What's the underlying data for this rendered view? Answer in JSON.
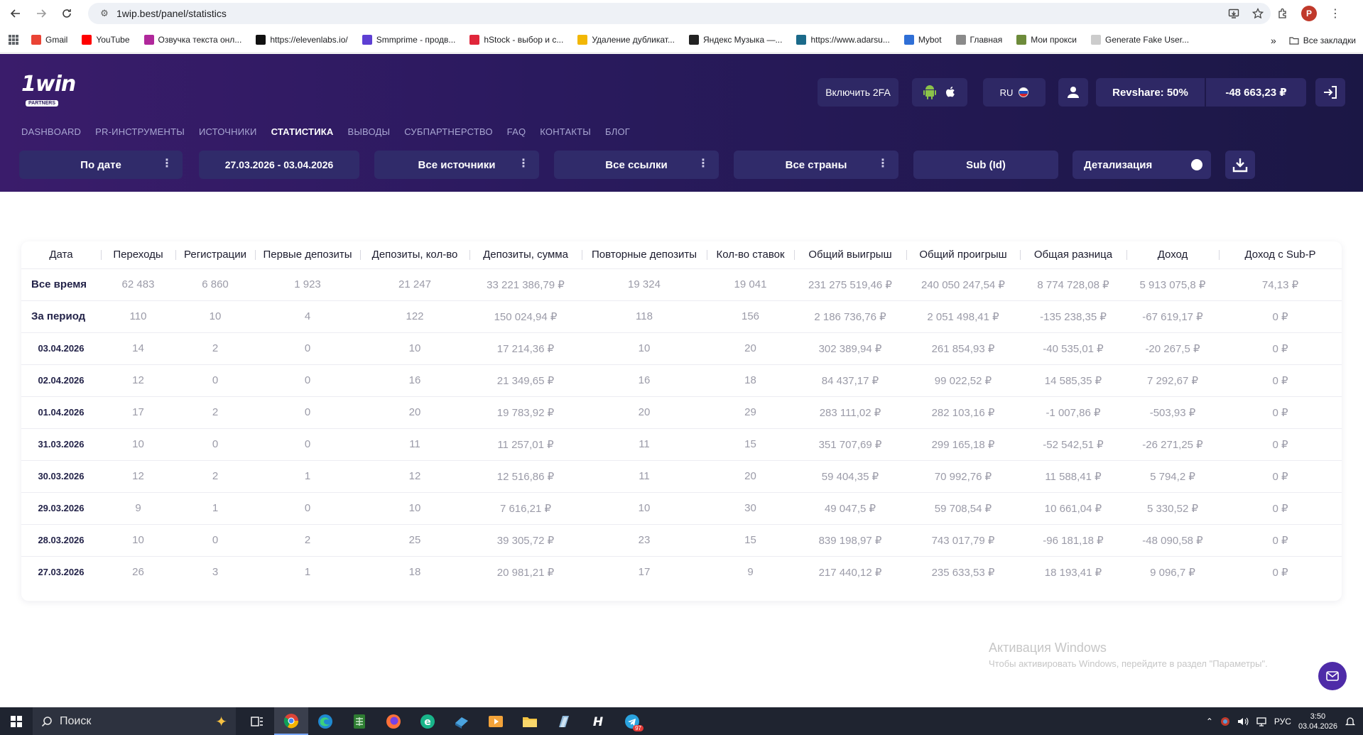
{
  "browser": {
    "url": "1wip.best/panel/statistics",
    "bookmarks": [
      {
        "label": "Gmail",
        "color": "#ea4335"
      },
      {
        "label": "YouTube",
        "color": "#ff0000"
      },
      {
        "label": "Озвучка текста онл...",
        "color": "#b0289b"
      },
      {
        "label": "https://elevenlabs.io/",
        "color": "#111111"
      },
      {
        "label": "Smmprime - продв...",
        "color": "#5d3fd3"
      },
      {
        "label": "hStock - выбор и с...",
        "color": "#e0263a"
      },
      {
        "label": "Удаление дубликат...",
        "color": "#f2b705"
      },
      {
        "label": "Яндекс Музыка —...",
        "color": "#222222"
      },
      {
        "label": "https://www.adarsu...",
        "color": "#1b6a8a"
      },
      {
        "label": "Mybot",
        "color": "#2f6fd6"
      },
      {
        "label": "Главная",
        "color": "#8a8a8a"
      },
      {
        "label": "Мои прокси",
        "color": "#6d8b3a"
      },
      {
        "label": "Generate Fake User...",
        "color": "#cccccc"
      }
    ],
    "all_bookmarks_label": "Все закладки",
    "profile_letter": "P"
  },
  "header": {
    "logo_text": "1win",
    "logo_sub": "PARTNERS",
    "twofa_label": "Включить 2FA",
    "lang_label": "RU",
    "revshare_label": "Revshare: 50%",
    "balance_label": "-48 663,23 ₽"
  },
  "nav": [
    {
      "label": "DASHBOARD",
      "active": false
    },
    {
      "label": "PR-ИНСТРУМЕНТЫ",
      "active": false
    },
    {
      "label": "ИСТОЧНИКИ",
      "active": false
    },
    {
      "label": "СТАТИСТИКА",
      "active": true
    },
    {
      "label": "ВЫВОДЫ",
      "active": false
    },
    {
      "label": "СУБПАРТНЕРСТВО",
      "active": false
    },
    {
      "label": "FAQ",
      "active": false
    },
    {
      "label": "КОНТАКТЫ",
      "active": false
    },
    {
      "label": "БЛОГ",
      "active": false
    }
  ],
  "filters": {
    "by_date": "По дате",
    "date_range": "27.03.2026 - 03.04.2026",
    "sources": "Все источники",
    "links": "Все ссылки",
    "countries": "Все страны",
    "sub": "Sub (Id)",
    "detail": "Детализация"
  },
  "table": {
    "columns": [
      "Дата",
      "Переходы",
      "Регистрации",
      "Первые депозиты",
      "Депозиты, кол-во",
      "Депозиты, сумма",
      "Повторные депозиты",
      "Кол-во ставок",
      "Общий выигрыш",
      "Общий проигрыш",
      "Общая разница",
      "Доход",
      "Доход с Sub-P"
    ],
    "rows": [
      {
        "kind": "summary",
        "cells": [
          "Все время",
          "62 483",
          "6 860",
          "1 923",
          "21 247",
          "33 221 386,79 ₽",
          "19 324",
          "19 041",
          "231 275 519,46 ₽",
          "240 050 247,54 ₽",
          "8 774 728,08 ₽",
          "5 913 075,8 ₽",
          "74,13 ₽"
        ]
      },
      {
        "kind": "summary",
        "cells": [
          "За период",
          "110",
          "10",
          "4",
          "122",
          "150 024,94 ₽",
          "118",
          "156",
          "2 186 736,76 ₽",
          "2 051 498,41 ₽",
          "-135 238,35 ₽",
          "-67 619,17 ₽",
          "0 ₽"
        ]
      },
      {
        "kind": "date",
        "cells": [
          "03.04.2026",
          "14",
          "2",
          "0",
          "10",
          "17 214,36 ₽",
          "10",
          "20",
          "302 389,94 ₽",
          "261 854,93 ₽",
          "-40 535,01 ₽",
          "-20 267,5 ₽",
          "0 ₽"
        ]
      },
      {
        "kind": "date",
        "cells": [
          "02.04.2026",
          "12",
          "0",
          "0",
          "16",
          "21 349,65 ₽",
          "16",
          "18",
          "84 437,17 ₽",
          "99 022,52 ₽",
          "14 585,35 ₽",
          "7 292,67 ₽",
          "0 ₽"
        ]
      },
      {
        "kind": "date",
        "cells": [
          "01.04.2026",
          "17",
          "2",
          "0",
          "20",
          "19 783,92 ₽",
          "20",
          "29",
          "283 111,02 ₽",
          "282 103,16 ₽",
          "-1 007,86 ₽",
          "-503,93 ₽",
          "0 ₽"
        ]
      },
      {
        "kind": "date",
        "cells": [
          "31.03.2026",
          "10",
          "0",
          "0",
          "11",
          "11 257,01 ₽",
          "11",
          "15",
          "351 707,69 ₽",
          "299 165,18 ₽",
          "-52 542,51 ₽",
          "-26 271,25 ₽",
          "0 ₽"
        ]
      },
      {
        "kind": "date",
        "cells": [
          "30.03.2026",
          "12",
          "2",
          "1",
          "12",
          "12 516,86 ₽",
          "11",
          "20",
          "59 404,35 ₽",
          "70 992,76 ₽",
          "11 588,41 ₽",
          "5 794,2 ₽",
          "0 ₽"
        ]
      },
      {
        "kind": "date",
        "cells": [
          "29.03.2026",
          "9",
          "1",
          "0",
          "10",
          "7 616,21 ₽",
          "10",
          "30",
          "49 047,5 ₽",
          "59 708,54 ₽",
          "10 661,04 ₽",
          "5 330,52 ₽",
          "0 ₽"
        ]
      },
      {
        "kind": "date",
        "cells": [
          "28.03.2026",
          "10",
          "0",
          "2",
          "25",
          "39 305,72 ₽",
          "23",
          "15",
          "839 198,97 ₽",
          "743 017,79 ₽",
          "-96 181,18 ₽",
          "-48 090,58 ₽",
          "0 ₽"
        ]
      },
      {
        "kind": "date",
        "cells": [
          "27.03.2026",
          "26",
          "3",
          "1",
          "18",
          "20 981,21 ₽",
          "17",
          "9",
          "217 440,12 ₽",
          "235 633,53 ₽",
          "18 193,41 ₽",
          "9 096,7 ₽",
          "0 ₽"
        ]
      }
    ]
  },
  "watermark": {
    "title": "Активация Windows",
    "subtitle": "Чтобы активировать Windows, перейдите в раздел \"Параметры\"."
  },
  "taskbar": {
    "search_label": "Поиск",
    "lang": "РУС",
    "time": "3:50",
    "date": "03.04.2026",
    "telegram_badge": "97"
  },
  "colors": {
    "header_start": "#3a1c6b",
    "header_end": "#1b1745",
    "pill_bg": "#2e2865",
    "row_text": "#9b9ba8",
    "label_text": "#232349"
  }
}
